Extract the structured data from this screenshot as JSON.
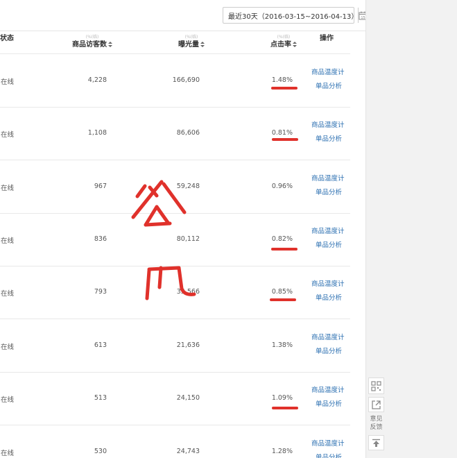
{
  "date_filter": {
    "label": "最近30天（2016-03-15~2016-04-13）",
    "calendar_day": "15"
  },
  "headers": {
    "status": "状态",
    "visitors_top": "(%(临)",
    "visitors": "商品访客数",
    "exposure_top": "(%(临)",
    "exposure": "曝光量",
    "ctr_top": "(%(临)",
    "ctr": "点击率",
    "action": "操作"
  },
  "rows": [
    {
      "status": "销售在线",
      "visitors": "4,228",
      "exposure": "166,690",
      "ctr": "1.48%",
      "action1": "商品温度计",
      "action2": "单品分析"
    },
    {
      "status": "销售在线",
      "visitors": "1,108",
      "exposure": "86,606",
      "ctr": "0.81%",
      "action1": "商品温度计",
      "action2": "单品分析"
    },
    {
      "status": "销售在线",
      "visitors": "967",
      "exposure": "59,248",
      "ctr": "0.96%",
      "action1": "商品温度计",
      "action2": "单品分析"
    },
    {
      "status": "销售在线",
      "visitors": "836",
      "exposure": "80,112",
      "ctr": "0.82%",
      "action1": "商品温度计",
      "action2": "单品分析"
    },
    {
      "status": "销售在线",
      "visitors": "793",
      "exposure": "35,566",
      "ctr": "0.85%",
      "action1": "商品温度计",
      "action2": "单品分析"
    },
    {
      "status": "销售在线",
      "visitors": "613",
      "exposure": "21,636",
      "ctr": "1.38%",
      "action1": "商品温度计",
      "action2": "单品分析"
    },
    {
      "status": "销售在线",
      "visitors": "513",
      "exposure": "24,150",
      "ctr": "1.09%",
      "action1": "商品温度计",
      "action2": "单品分析"
    },
    {
      "status": "销售在线",
      "visitors": "530",
      "exposure": "24,743",
      "ctr": "1.28%",
      "action1": "商品温度计",
      "action2": "单品分析"
    }
  ],
  "sidebar": {
    "feedback": "意见反馈"
  },
  "colors": {
    "link": "#2b6fb1",
    "annotation": "#e0312b"
  }
}
